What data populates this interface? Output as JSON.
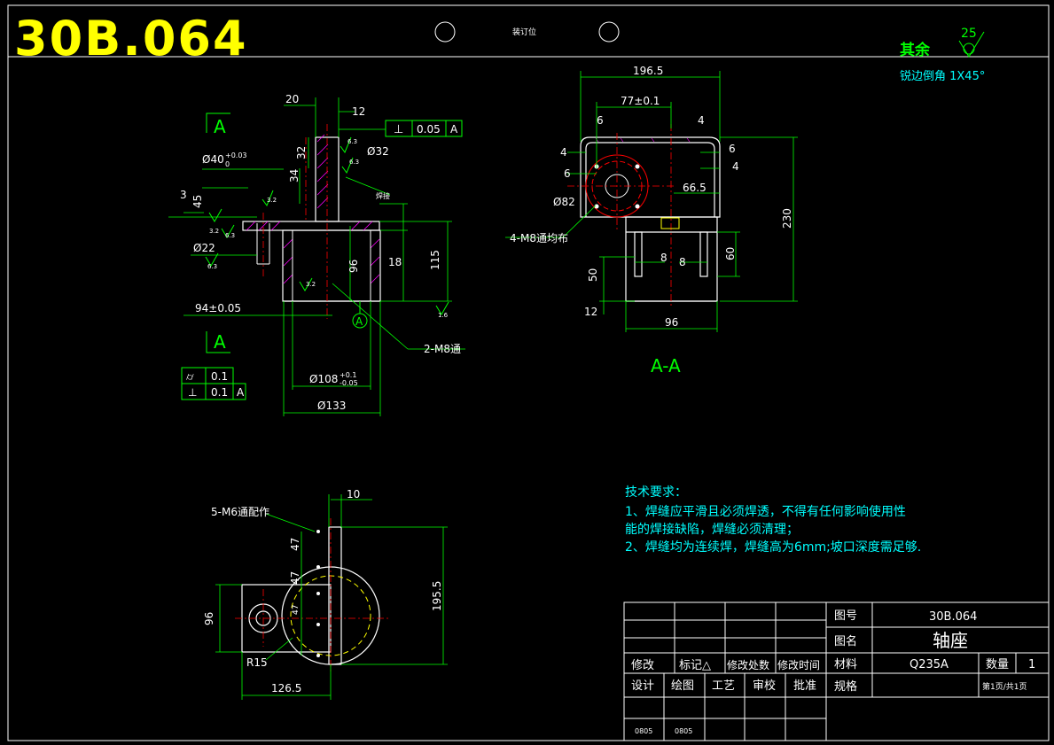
{
  "header": {
    "drawing_code": "30B.064",
    "binding_label": "装订位",
    "roughness_other_label": "其余",
    "roughness_other_value": "25",
    "edge_note": "锐边倒角 1X45°"
  },
  "colors": {
    "background": "#000000",
    "border": "#ffffff",
    "dimension": "#00ff00",
    "text_cyan": "#00ffff",
    "title_yellow": "#ffff00",
    "center_red": "#ff0000",
    "hatch_magenta": "#ff00ff"
  },
  "front_view": {
    "section_mark_top": "A",
    "section_mark_bottom": "A",
    "dims": {
      "d20": "20",
      "d12": "12",
      "d32": "32",
      "d34": "34",
      "d3": "3",
      "d45": "45",
      "d18": "18",
      "d96": "96",
      "d115": "115",
      "phi40": "Ø40",
      "phi40_tol_upper": "+0.03",
      "phi40_tol_lower": "0",
      "phi32": "Ø32",
      "phi22": "Ø22",
      "d94": "94±0.05",
      "phi108": "Ø108",
      "phi108_tol_upper": "+0.1",
      "phi108_tol_lower": "-0.05",
      "phi133": "Ø133",
      "hole_note": "2-M8通",
      "datum_label": "A",
      "weld_note": "焊接"
    },
    "gdt_top": {
      "symbol": "⊥",
      "value": "0.05",
      "datum": "A"
    },
    "gdt_bottom": [
      {
        "symbol": "⌭",
        "value": "0.1",
        "datum": ""
      },
      {
        "symbol": "⊥",
        "value": "0.1",
        "datum": "A"
      }
    ],
    "roughness": [
      "6.3",
      "6.3",
      "3.2",
      "3.2",
      "6.3",
      "6.3",
      "3.2",
      "1.6"
    ]
  },
  "section_view": {
    "label": "A-A",
    "dims": {
      "d196_5": "196.5",
      "d77": "77±0.1",
      "d6a": "6",
      "d4a": "4",
      "d4b": "4",
      "d6b": "6",
      "d6c": "6",
      "d4c": "4",
      "d66_5": "66.5",
      "phi82": "Ø82",
      "d230": "230",
      "d8a": "8",
      "d8b": "8",
      "d60": "60",
      "d50": "50",
      "d12": "12",
      "d96": "96",
      "hole_note": "4-M8通均布"
    }
  },
  "top_view": {
    "dims": {
      "d10": "10",
      "d47a": "47",
      "d47b": "47",
      "d47c": "47",
      "d96": "96",
      "d195_5": "195.5",
      "r15": "R15",
      "d126_5": "126.5",
      "hole_note": "5-M6通配作"
    }
  },
  "tech_requirements": {
    "title": "技术要求：",
    "lines": [
      "1、焊缝应平滑且必须焊透，不得有任何影响使用性",
      "能的焊接缺陷，焊缝必须清理；",
      "2、焊缝均为连续焊，焊缝高为6mm;坡口深度需足够."
    ]
  },
  "title_block": {
    "drawing_no_label": "图号",
    "drawing_no_value": "30B.064",
    "name_label": "图名",
    "name_value": "轴座",
    "material_label": "材料",
    "material_value": "Q235A",
    "qty_label": "数量",
    "qty_value": "1",
    "spec_label": "规格",
    "sheet_value": "第1页/共1页",
    "revision_headers": [
      "修改",
      "标记△",
      "修改处数",
      "修改时间"
    ],
    "signoff_headers": [
      "设计",
      "绘图",
      "工艺",
      "审校",
      "批准"
    ],
    "dates": [
      "0805",
      "0805"
    ]
  }
}
